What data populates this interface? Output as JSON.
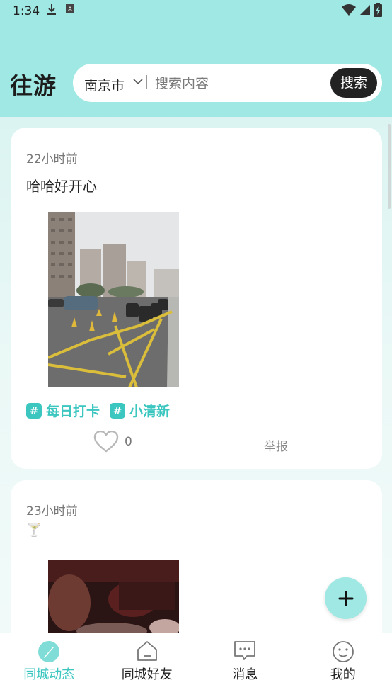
{
  "status_bar": {
    "time": "1:34"
  },
  "header": {
    "logo": "往游",
    "city": "南京市",
    "search_placeholder": "搜索内容",
    "search_button": "搜索"
  },
  "posts": [
    {
      "time": "22小时前",
      "content": "哈哈好开心",
      "tags": [
        "每日打卡",
        "小清新"
      ],
      "likes": "0",
      "report": "举报"
    },
    {
      "time": "23小时前",
      "content": "🍸"
    }
  ],
  "fab": {
    "icon": "plus-icon"
  },
  "bottom_nav": [
    {
      "label": "同城动态",
      "icon": "compass-icon",
      "active": true
    },
    {
      "label": "同城好友",
      "icon": "home-icon",
      "active": false
    },
    {
      "label": "消息",
      "icon": "chat-icon",
      "active": false
    },
    {
      "label": "我的",
      "icon": "smile-icon",
      "active": false
    }
  ],
  "colors": {
    "accent": "#3cc6c0",
    "header_bg": "#9fe8e3",
    "search_button": "#222222"
  }
}
